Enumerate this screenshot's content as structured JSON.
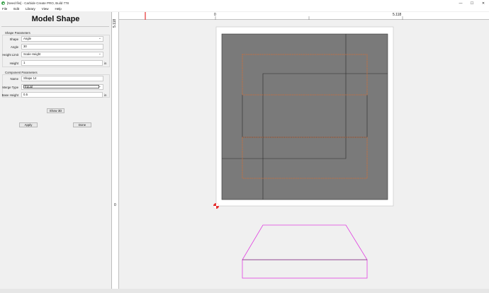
{
  "window": {
    "title": "[Need file] - Carbide Create PRO, Build 778",
    "controls": {
      "minimize": "—",
      "maximize": "☐",
      "close": "✕"
    }
  },
  "menu": [
    "File",
    "Edit",
    "Library",
    "View",
    "Help"
  ],
  "panel": {
    "title": "Model Shape",
    "shape_params_label": "Shape Parameters",
    "shape_label": "Shape",
    "shape_value": "Angle",
    "angle_label": "Angle",
    "angle_value": "30",
    "height_limit_label": "Height Limit",
    "height_limit_value": "Scale Height",
    "height_label": "Height",
    "height_value": "1",
    "height_unit": "in",
    "component_params_label": "Component Parameters",
    "name_label": "Name",
    "name_value": "Shape 14",
    "merge_type_label": "Merge Type",
    "merge_type_value": "Equal",
    "base_height_label": "Base Height",
    "base_height_value": "0.5",
    "base_height_unit": "in",
    "show3d_label": "Show 3D",
    "apply_label": "Apply",
    "done_label": "Done"
  },
  "rulers": {
    "top_zero": "0",
    "top_end": "5.118",
    "left_top": "5.118",
    "left_zero": "0"
  },
  "colors": {
    "stock": "#7a7a7a",
    "toolpath_outline": "#e06b2c",
    "profile_line": "#e040e0",
    "cursor_marker": "#e53030"
  },
  "icons": {
    "app": "carbide-create-icon",
    "origin": "origin-marker-icon"
  }
}
